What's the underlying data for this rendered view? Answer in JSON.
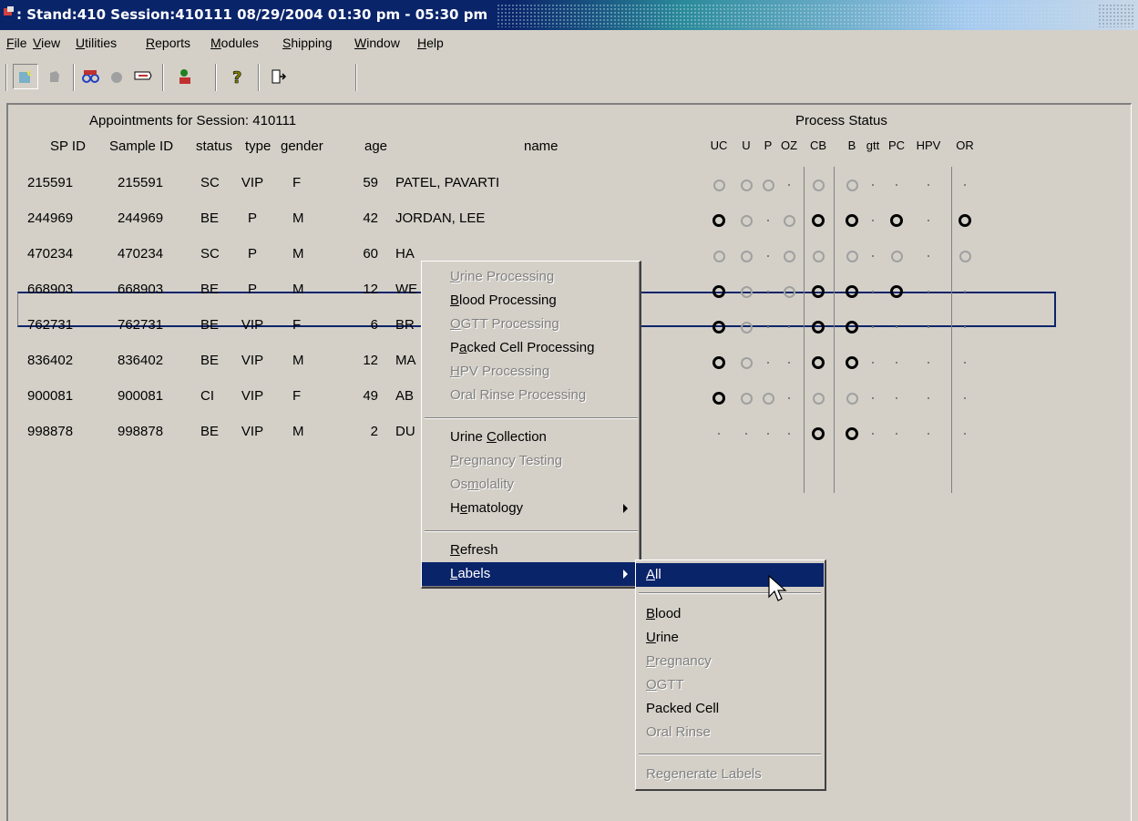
{
  "window": {
    "title": ": Stand:410 Session:410111 08/29/2004 01:30 pm - 05:30 pm"
  },
  "menubar": {
    "items": [
      {
        "pre": "",
        "u": "F",
        "post": "ile"
      },
      {
        "pre": "",
        "u": "V",
        "post": "iew"
      },
      {
        "pre": "",
        "u": "U",
        "post": "tilities"
      },
      {
        "pre": "",
        "u": "R",
        "post": "eports"
      },
      {
        "pre": "",
        "u": "M",
        "post": "odules"
      },
      {
        "pre": "",
        "u": "S",
        "post": "hipping"
      },
      {
        "pre": "",
        "u": "W",
        "post": "indow"
      },
      {
        "pre": "",
        "u": "H",
        "post": "elp"
      }
    ]
  },
  "toolbar": {
    "icons": [
      "new-icon",
      "disabled-icon",
      "glasses-icon",
      "disabled-icon-2",
      "labels-icon",
      "person-icon",
      "help-icon",
      "exit-icon"
    ]
  },
  "appointments": {
    "heading": "Appointments for Session: 410111",
    "process_heading": "Process Status",
    "columns": [
      "SP ID",
      "Sample ID",
      "status",
      "type",
      "gender",
      "age",
      "name"
    ],
    "process_columns": [
      "UC",
      "U",
      "P",
      "OZ",
      "CB",
      "B",
      "gtt",
      "PC",
      "HPV",
      "OR"
    ],
    "rows": [
      {
        "sp_id": "215591",
        "sample_id": "215591",
        "status": "SC",
        "type": "VIP",
        "gender": "F",
        "age": "59",
        "name": "PATEL, PAVARTI",
        "proc": [
          "g",
          "g",
          "g",
          ".",
          "g",
          "g",
          ".",
          ".",
          ".",
          "."
        ]
      },
      {
        "sp_id": "244969",
        "sample_id": "244969",
        "status": "BE",
        "type": "P",
        "gender": "M",
        "age": "42",
        "name": "JORDAN, LEE",
        "proc": [
          "d",
          "g",
          ".",
          "g",
          "d",
          "d",
          ".",
          "d",
          ".",
          "d"
        ]
      },
      {
        "sp_id": "470234",
        "sample_id": "470234",
        "status": "SC",
        "type": "P",
        "gender": "M",
        "age": "60",
        "name": "HA",
        "proc": [
          "g",
          "g",
          ".",
          "g",
          "g",
          "g",
          ".",
          "g",
          ".",
          "g"
        ]
      },
      {
        "sp_id": "668903",
        "sample_id": "668903",
        "status": "BE",
        "type": "P",
        "gender": "M",
        "age": "12",
        "name": "WE",
        "proc": [
          "d",
          "g",
          ".",
          "g",
          "d",
          "d",
          ".",
          "d",
          ".",
          "."
        ]
      },
      {
        "sp_id": "762731",
        "sample_id": "762731",
        "status": "BE",
        "type": "VIP",
        "gender": "F",
        "age": "6",
        "name": "BR",
        "proc": [
          "d",
          "g",
          ".",
          ".",
          "d",
          "d",
          ".",
          ".",
          ".",
          "."
        ]
      },
      {
        "sp_id": "836402",
        "sample_id": "836402",
        "status": "BE",
        "type": "VIP",
        "gender": "M",
        "age": "12",
        "name": "MA",
        "proc": [
          "d",
          "g",
          ".",
          ".",
          "d",
          "d",
          ".",
          ".",
          ".",
          "."
        ]
      },
      {
        "sp_id": "900081",
        "sample_id": "900081",
        "status": "CI",
        "type": "VIP",
        "gender": "F",
        "age": "49",
        "name": "AB",
        "proc": [
          "d",
          "g",
          "g",
          ".",
          "g",
          "g",
          ".",
          ".",
          ".",
          "."
        ]
      },
      {
        "sp_id": "998878",
        "sample_id": "998878",
        "status": "BE",
        "type": "VIP",
        "gender": "M",
        "age": "2",
        "name": "DU",
        "proc": [
          ".",
          ".",
          ".",
          ".",
          "d",
          "d",
          ".",
          ".",
          ".",
          "."
        ]
      }
    ]
  },
  "context_menu": {
    "items": [
      {
        "pre": "",
        "u": "U",
        "post": "rine Processing",
        "enabled": false
      },
      {
        "pre": "",
        "u": "B",
        "post": "lood Processing",
        "enabled": true
      },
      {
        "pre": "",
        "u": "O",
        "post": "GTT Processing",
        "enabled": false
      },
      {
        "pre": "P",
        "u": "a",
        "post": "cked Cell Processing",
        "enabled": true
      },
      {
        "pre": "",
        "u": "H",
        "post": "PV Processing",
        "enabled": false
      },
      {
        "pre": "Oral Rinse Processing",
        "u": "",
        "post": "",
        "enabled": false
      },
      {
        "pre": "Urine ",
        "u": "C",
        "post": "ollection",
        "enabled": true
      },
      {
        "pre": "",
        "u": "P",
        "post": "regnancy Testing",
        "enabled": false
      },
      {
        "pre": "Os",
        "u": "m",
        "post": "olality",
        "enabled": false
      },
      {
        "pre": "H",
        "u": "e",
        "post": "matology",
        "enabled": true
      },
      {
        "pre": "",
        "u": "R",
        "post": "efresh",
        "enabled": true
      },
      {
        "pre": "",
        "u": "L",
        "post": "abels",
        "enabled": true
      }
    ]
  },
  "labels_submenu": {
    "items": [
      {
        "pre": "",
        "u": "A",
        "post": "ll",
        "enabled": true
      },
      {
        "pre": "",
        "u": "B",
        "post": "lood",
        "enabled": true
      },
      {
        "pre": "",
        "u": "U",
        "post": "rine",
        "enabled": true
      },
      {
        "pre": "",
        "u": "P",
        "post": "regnancy",
        "enabled": false
      },
      {
        "pre": "",
        "u": "O",
        "post": "GTT",
        "enabled": false
      },
      {
        "pre": "Packed Cell",
        "u": "",
        "post": "",
        "enabled": true
      },
      {
        "pre": "Oral Rinse",
        "u": "",
        "post": "",
        "enabled": false
      },
      {
        "pre": "Regenerate Labels",
        "u": "",
        "post": "",
        "enabled": false
      }
    ]
  }
}
